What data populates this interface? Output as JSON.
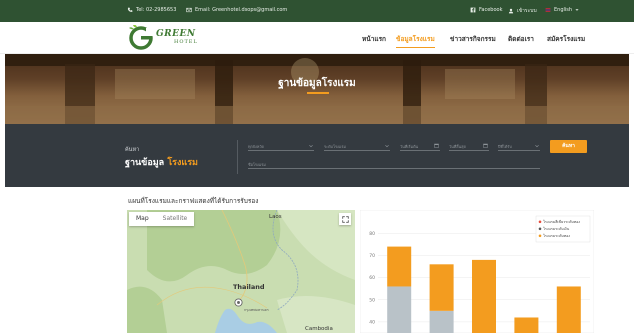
{
  "topbar": {
    "phone": "Tel: 02-2985653",
    "email": "Email: Greenhotel.dsops@gmail.com",
    "facebook": "Facebook",
    "login": "เข้าระบบ",
    "language": "English"
  },
  "header": {
    "logo_text": "GREEN",
    "logo_sub": "HOTEL",
    "nav": [
      "หน้าแรก",
      "ข้อมูลโรงแรม",
      "ข่าวสารกิจกรรม",
      "ติดต่อเรา",
      "สมัครโรงแรม"
    ],
    "active_index": 1
  },
  "banner": {
    "title": "ฐานข้อมูลโรงแรม"
  },
  "search": {
    "label_small": "ค้นหา",
    "label_main": "ฐานข้อมูล",
    "label_highlight": "โรงแรม",
    "fields": [
      "ทุกจังหวัด",
      "ระดับโรงแรม",
      "วันที่เริ่มต้น",
      "วันที่สิ้นสุด",
      "ปีที่ได้รับ"
    ],
    "keyword_placeholder": "ชื่อโรงแรม",
    "button": "ค้นหา"
  },
  "section": {
    "title": "แผนที่โรงแรมและกราฟแสดงที่ได้รับการรับรอง"
  },
  "map": {
    "tabs": [
      "Map",
      "Satellite"
    ],
    "labels": {
      "laos": "Laos",
      "thailand": "Thailand",
      "cambodia": "Cambodia",
      "bangkok": "กรุงเทพมหานคร"
    }
  },
  "chart_data": {
    "type": "bar",
    "stacked": true,
    "categories": [
      "",
      "",
      "",
      "",
      ""
    ],
    "series": [
      {
        "name": "",
        "values": [
          56,
          45,
          0,
          0,
          0
        ],
        "color": "#b9c2c8"
      },
      {
        "name": "",
        "values": [
          18,
          21,
          68,
          42,
          56
        ],
        "color": "#f39c1f"
      }
    ],
    "legend": [
      "โรงแรมสีเขียวระดับทอง",
      "โรงแรมระดับเงิน",
      "โรงแรมระดับทอง"
    ],
    "legend_colors": [
      "#e74c3c",
      "#555555",
      "#f39c1f"
    ],
    "y_ticks": [
      "40",
      "50",
      "60",
      "70",
      "80"
    ],
    "ylim": [
      35,
      86
    ],
    "grid": true,
    "legend_position": "top-right"
  }
}
